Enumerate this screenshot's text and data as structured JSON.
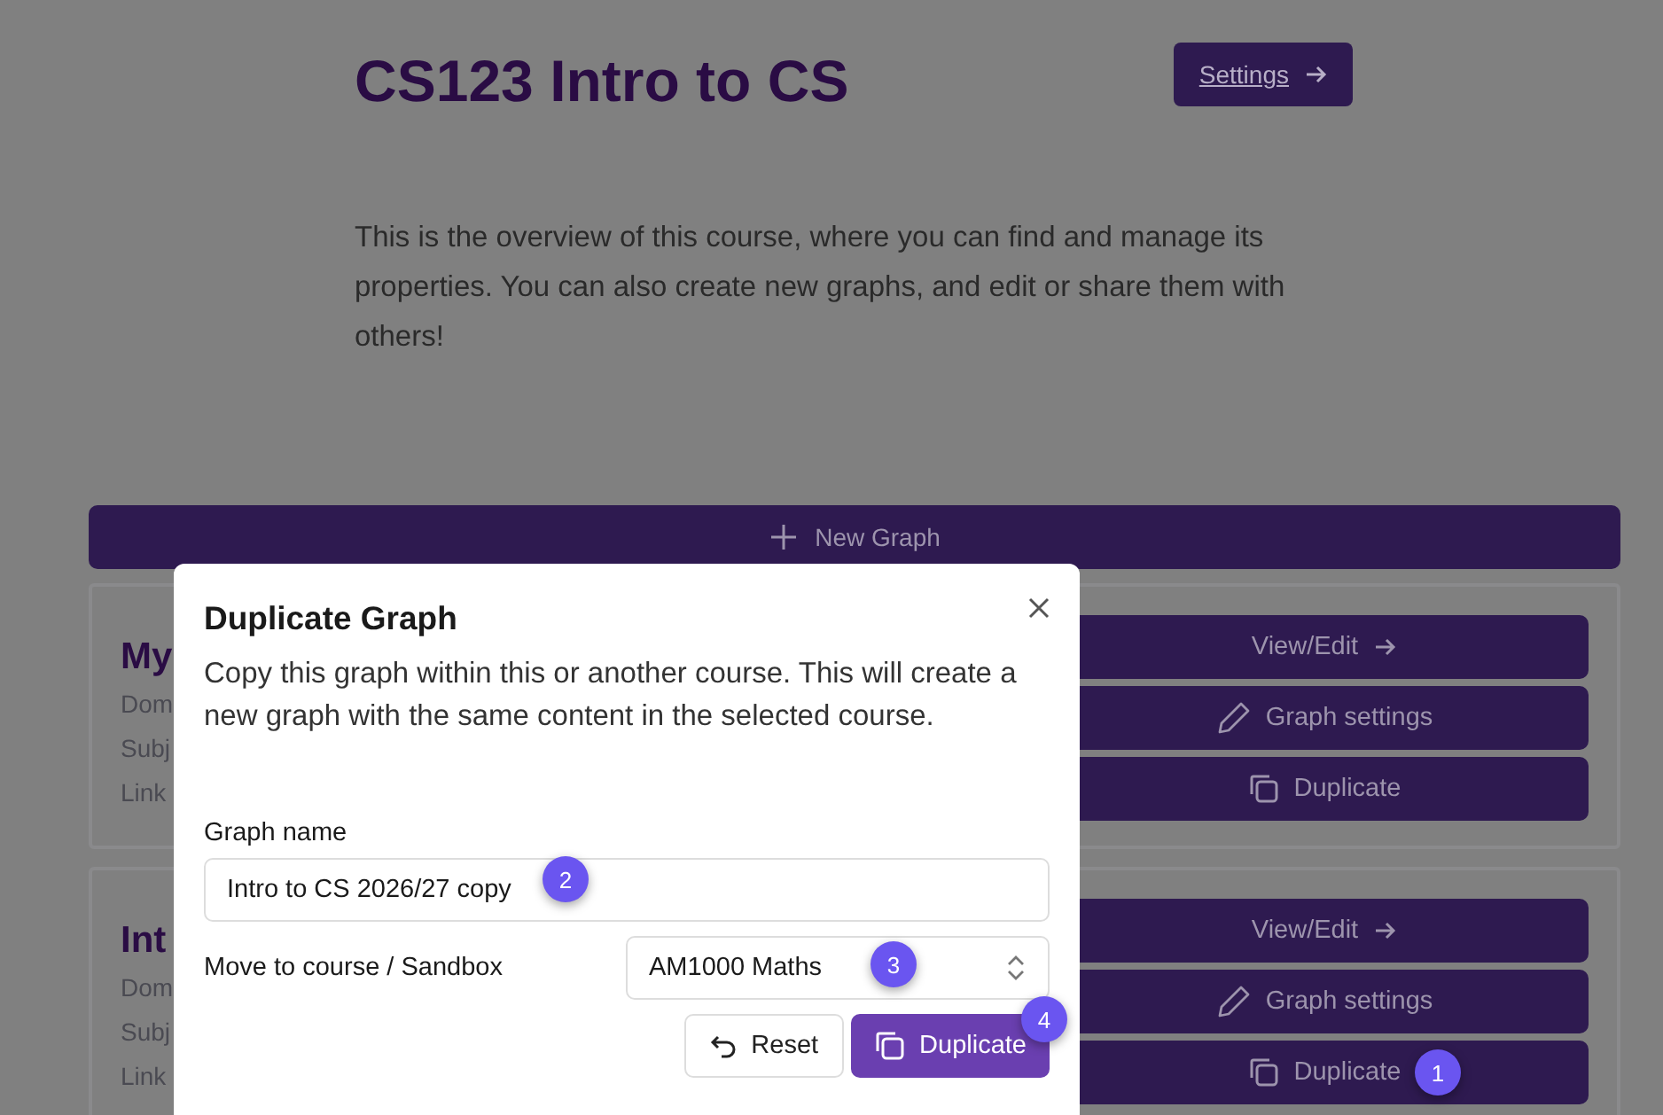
{
  "page": {
    "title": "CS123 Intro to CS",
    "settings_button": "Settings",
    "description": "This is the overview of this course, where you can find and manage its properties. You can also create new graphs, and edit or share them with others!",
    "new_graph_button": "New Graph"
  },
  "graph_cards": [
    {
      "title": "My",
      "lines": [
        "Dom",
        "Subj",
        "Link"
      ],
      "buttons": [
        {
          "kind": "view",
          "label": "View/Edit"
        },
        {
          "kind": "settings",
          "label": "Graph settings"
        },
        {
          "kind": "duplicate",
          "label": "Duplicate"
        }
      ]
    },
    {
      "title": "Int",
      "lines": [
        "Dom",
        "Subj",
        "Link"
      ],
      "buttons": [
        {
          "kind": "view",
          "label": "View/Edit"
        },
        {
          "kind": "settings",
          "label": "Graph settings"
        },
        {
          "kind": "duplicate",
          "label": "Duplicate",
          "badge": "1"
        }
      ]
    }
  ],
  "dialog": {
    "title": "Duplicate Graph",
    "description": "Copy this graph within this or another course. This will create a new graph with the same content in the selected course.",
    "fields": [
      {
        "kind": "text",
        "label": "Graph name",
        "value": "Intro to CS 2026/27 copy",
        "badge": "2"
      },
      {
        "kind": "select",
        "label": "Move to course / Sandbox",
        "value": "AM1000 Maths",
        "badge": "3"
      }
    ],
    "buttons": [
      {
        "kind": "reset",
        "label": "Reset"
      },
      {
        "kind": "duplicate",
        "label": "Duplicate",
        "badge": "4"
      }
    ]
  }
}
